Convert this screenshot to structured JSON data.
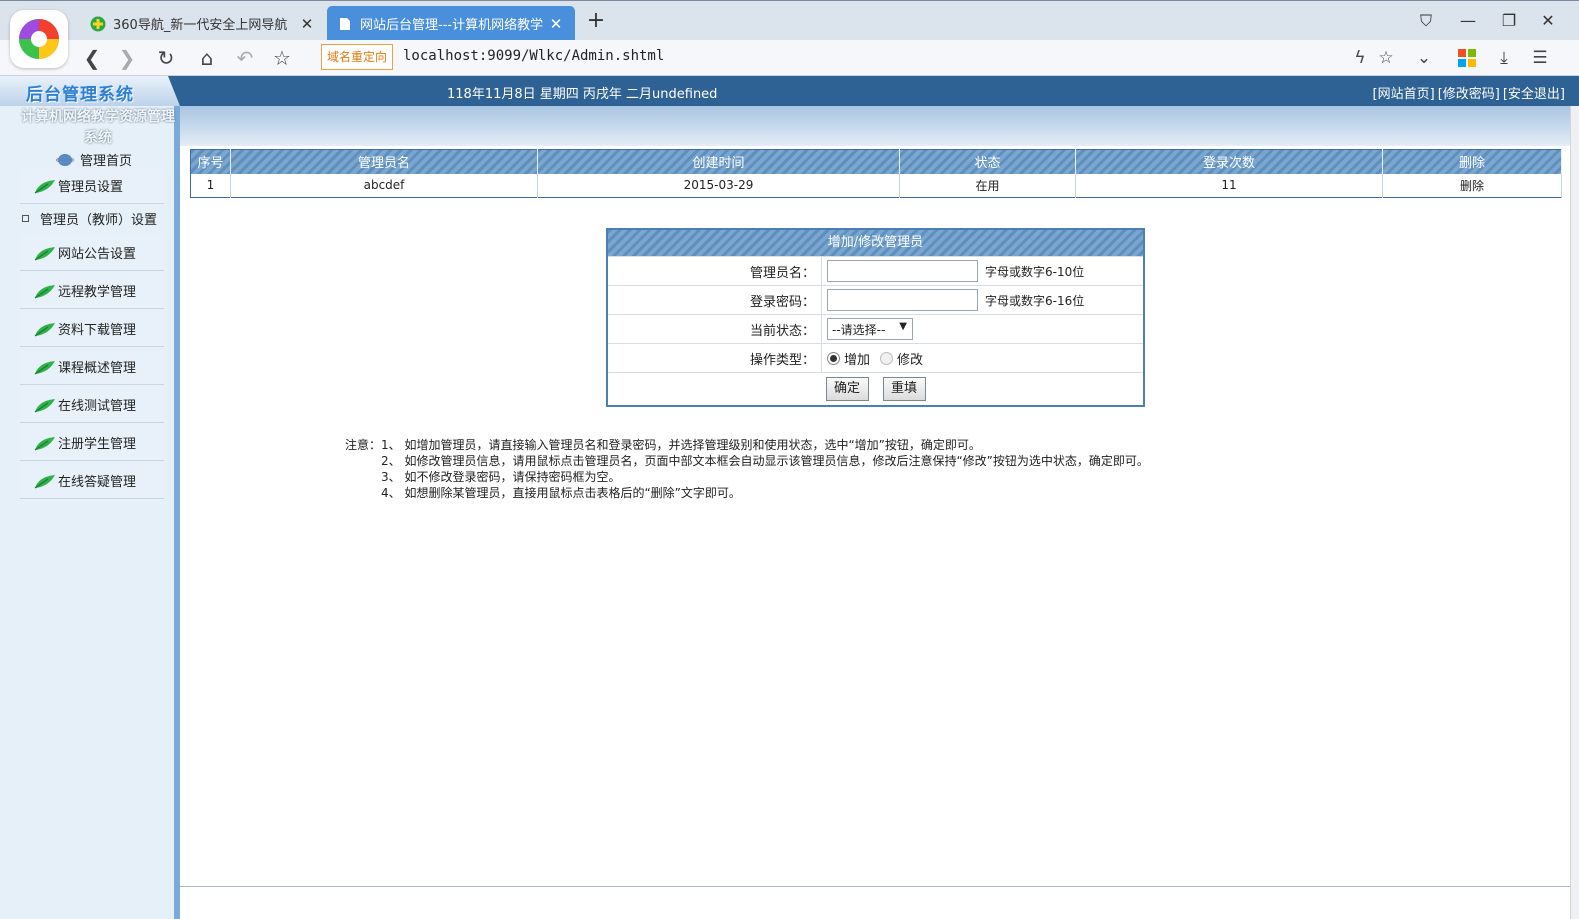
{
  "browser": {
    "tabs": [
      {
        "title": "360导航_新一代安全上网导航",
        "active": false
      },
      {
        "title": "网站后台管理---计算机网络教学",
        "active": true
      }
    ],
    "redirect_badge": "域名重定向",
    "url": "localhost:9099/Wlkc/Admin.shtml",
    "icons": [
      "back-icon",
      "forward-icon",
      "reload-icon",
      "home-icon",
      "undo-icon",
      "star-icon",
      "lightning-icon",
      "bookmark-icon",
      "dropdown-icon",
      "apps-icon",
      "download-icon",
      "menu-icon"
    ]
  },
  "header": {
    "logo_text": "后台管理系统",
    "date_text": "118年11月8日 星期四 丙戌年 二月undefined",
    "links": [
      "[网站首页]",
      "[修改密码]",
      "[安全退出]"
    ]
  },
  "sidebar": {
    "system_title": "计算机网络教学资源管理系统",
    "home_label": "管理首页",
    "items": [
      "管理员设置",
      "网站公告设置",
      "远程教学管理",
      "资料下载管理",
      "课程概述管理",
      "在线测试管理",
      "注册学生管理",
      "在线答疑管理"
    ],
    "sub_item": "管理员（教师）设置"
  },
  "table": {
    "headers": [
      "序号",
      "管理员名",
      "创建时间",
      "状态",
      "登录次数",
      "删除"
    ],
    "rows": [
      [
        "1",
        "abcdef",
        "2015-03-29",
        "在用",
        "11",
        "删除"
      ]
    ]
  },
  "form": {
    "title": "增加/修改管理员",
    "username_label": "管理员名：",
    "username_value": "",
    "username_hint": "字母或数字6-10位",
    "password_label": "登录密码：",
    "password_value": "",
    "password_hint": "字母或数字6-16位",
    "status_label": "当前状态：",
    "status_selected": "--请选择--",
    "optype_label": "操作类型：",
    "optype_add": "增加",
    "optype_edit": "修改",
    "submit": "确定",
    "reset": "重填"
  },
  "notes": {
    "lead": "注意：",
    "lines": [
      "1、 如增加管理员，请直接输入管理员名和登录密码，并选择管理级别和使用状态，选中“增加”按钮，确定即可。",
      "2、 如修改管理员信息，请用鼠标点击管理员名，页面中部文本框会自动显示该管理员信息，修改后注意保持“修改”按钮为选中状态，确定即可。",
      "3、 如不修改登录密码，请保持密码框为空。",
      "4、 如想删除某管理员，直接用鼠标点击表格后的“删除”文字即可。"
    ]
  },
  "colors": {
    "header_blue": "#2f6294",
    "tab_active": "#4a8fdb",
    "table_border": "#3c6ea6",
    "sidebar_bg": "#e6f0f9"
  }
}
